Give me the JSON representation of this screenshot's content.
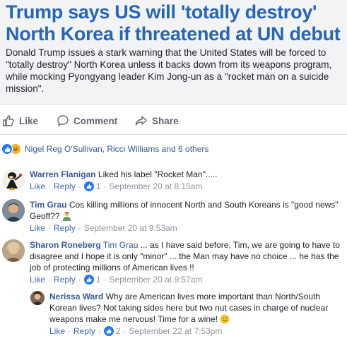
{
  "article": {
    "headline": "Trump says US will 'totally destroy' North Korea if threatened at UN debut",
    "summary": "Donald Trump issues a stark warning that the United States will be forced to \"totally destroy\" North Korea unless it backs down from its weapons program, while mocking Pyongyang leader Kim Jong-un as a \"rocket man on a suicide mission\"."
  },
  "actions": {
    "like": "Like",
    "comment": "Comment",
    "share": "Share"
  },
  "reactions": {
    "text": "Nigel Reg O'Sullivan, Ricci Williams and 6 others"
  },
  "comments": [
    {
      "name": "Warren Flanigan",
      "text": "Liked his label \"Rocket Man\".....",
      "like": "Like",
      "reply": "Reply",
      "likes": "1",
      "time": "September 20 at 8:15am"
    },
    {
      "name": "Tim Grau",
      "text": "Cos killing millions of innocent North and South Koreans is \"good news\" Geoff??",
      "like": "Like",
      "reply": "Reply",
      "time": "September 20 at 9:53am"
    },
    {
      "name": "Sharon Roneberg",
      "tag": "Tim Grau",
      "text": " ... as I have said before, Tim, we are going to have to disagree and I hope it is only \"minor\" ... the Man may have no choice ... he has the job of protecting millions of American lives !!",
      "like": "Like",
      "reply": "Reply",
      "likes": "1",
      "time": "September 20 at 9:57am"
    },
    {
      "name": "Nerissa Ward",
      "text": "Why are American lives more important than North/South Korean lives? Not taking sides here but two nut cases in charge of nuclear weapons make me nervous! Time for a wine!",
      "like": "Like",
      "reply": "Reply",
      "likes": "2",
      "time": "September 22 at 7:53pm"
    }
  ],
  "colors": {
    "headline": "#2766b5",
    "link": "#385898",
    "meta": "#90949c",
    "like_blue": "#2078f4"
  }
}
